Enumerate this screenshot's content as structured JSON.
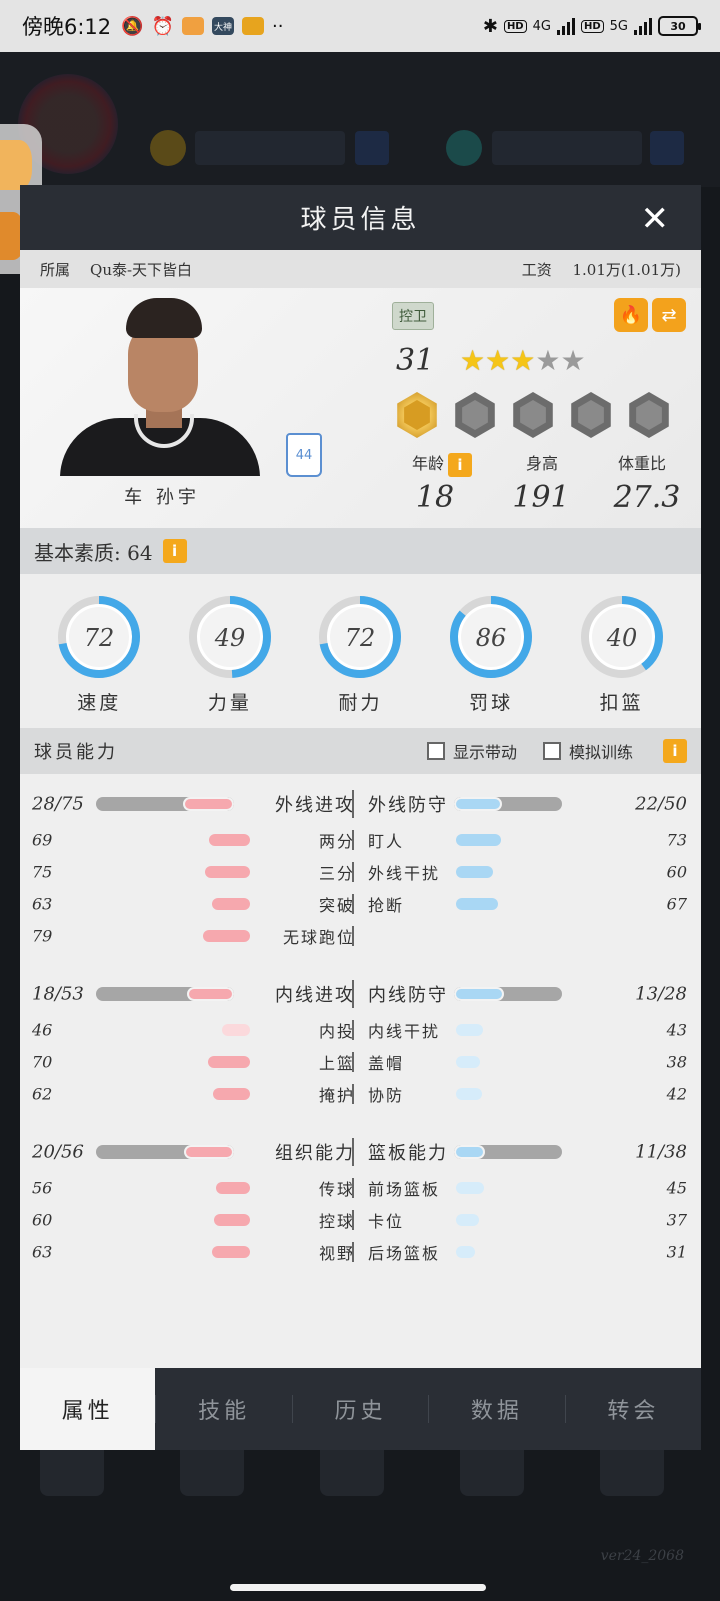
{
  "status_bar": {
    "time": "傍晚6:12",
    "icons": [
      "mute-bell-icon",
      "alarm-icon",
      "app-hamster-icon",
      "app-dashen-icon",
      "app-message-icon",
      "more-dots-icon"
    ],
    "app_dashen_label": "大神",
    "network_1": "4G",
    "network_2": "5G",
    "hd": "HD",
    "battery": "30"
  },
  "panel": {
    "title": "球员信息",
    "team_label": "所属",
    "team_name": "Qu泰-天下皆白",
    "salary_label": "工资",
    "salary_value": "1.01万(1.01万)"
  },
  "player": {
    "name": "车 孙宇",
    "number": "44",
    "position": "控卫",
    "overall": "31",
    "stars_filled": 3,
    "stars_total": 5,
    "age_label": "年龄",
    "height_label": "身高",
    "bmi_label": "体重比",
    "age": "18",
    "height": "191",
    "bmi": "27.3"
  },
  "basic": {
    "label": "基本素质: 64",
    "attributes": [
      {
        "label": "速度",
        "value": 72
      },
      {
        "label": "力量",
        "value": 49
      },
      {
        "label": "耐力",
        "value": 72
      },
      {
        "label": "罚球",
        "value": 86
      },
      {
        "label": "扣篮",
        "value": 40
      }
    ]
  },
  "ability": {
    "title": "球员能力",
    "show_drive_label": "显示带动",
    "sim_train_label": "模拟训练",
    "groups": [
      {
        "left_name": "外线进攻",
        "left_total": "28/75",
        "left_ratio": 0.37,
        "right_name": "外线防守",
        "right_total": "22/50",
        "right_ratio": 0.44,
        "rows": [
          {
            "lv": "69",
            "ln": "两分",
            "rn": "盯人",
            "rv": "73"
          },
          {
            "lv": "75",
            "ln": "三分",
            "rn": "外线干扰",
            "rv": "60"
          },
          {
            "lv": "63",
            "ln": "突破",
            "rn": "抢断",
            "rv": "67"
          },
          {
            "lv": "79",
            "ln": "无球跑位",
            "rn": "",
            "rv": ""
          }
        ]
      },
      {
        "left_name": "内线进攻",
        "left_total": "18/53",
        "left_ratio": 0.34,
        "right_name": "内线防守",
        "right_total": "13/28",
        "right_ratio": 0.46,
        "rows": [
          {
            "lv": "46",
            "ln": "内投",
            "rn": "内线干扰",
            "rv": "43"
          },
          {
            "lv": "70",
            "ln": "上篮",
            "rn": "盖帽",
            "rv": "38"
          },
          {
            "lv": "62",
            "ln": "掩护",
            "rn": "协防",
            "rv": "42"
          }
        ]
      },
      {
        "left_name": "组织能力",
        "left_total": "20/56",
        "left_ratio": 0.36,
        "right_name": "篮板能力",
        "right_total": "11/38",
        "right_ratio": 0.29,
        "rows": [
          {
            "lv": "56",
            "ln": "传球",
            "rn": "前场篮板",
            "rv": "45"
          },
          {
            "lv": "60",
            "ln": "控球",
            "rn": "卡位",
            "rv": "37"
          },
          {
            "lv": "63",
            "ln": "视野",
            "rn": "后场篮板",
            "rv": "31"
          }
        ]
      }
    ]
  },
  "tabs": [
    "属性",
    "技能",
    "历史",
    "数据",
    "转会"
  ],
  "active_tab": "属性",
  "version": "ver24_2068",
  "colors": {
    "accent_orange": "#f4a81c",
    "offense_pink": "#f6a8ae",
    "defense_blue": "#a9d7f4",
    "ring_blue": "#43a8e8",
    "header_dark": "#2a2e35"
  }
}
